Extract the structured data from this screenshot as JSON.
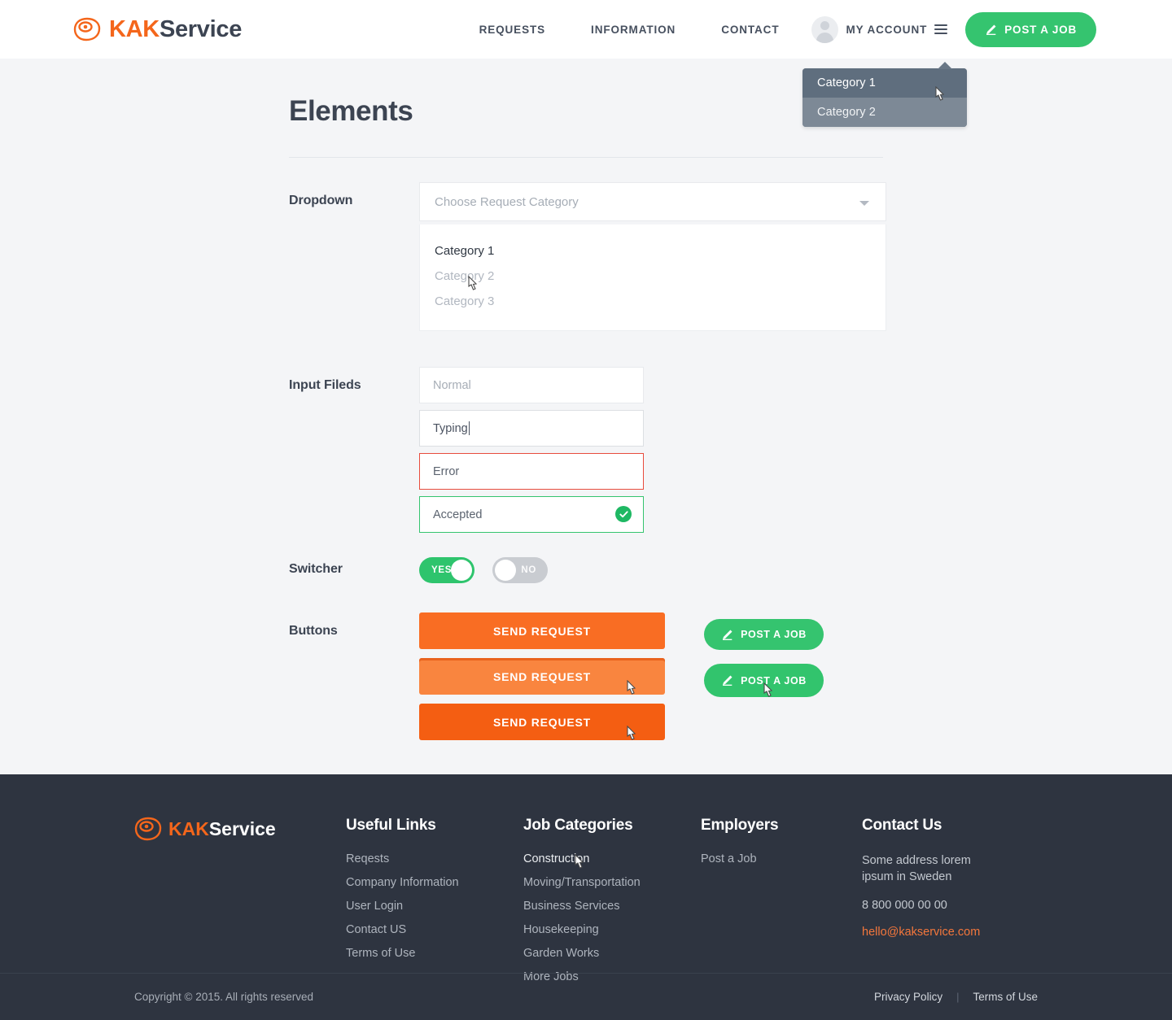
{
  "brand": {
    "mark": "kak-logo-icon",
    "name_primary": "KAK",
    "name_secondary": "Service"
  },
  "header": {
    "nav": [
      {
        "label": "REQUESTS"
      },
      {
        "label": "INFORMATION"
      },
      {
        "label": "CONTACT"
      }
    ],
    "account_label": "MY ACCOUNT",
    "post_job_label": "POST A JOB"
  },
  "tooltip_menu": {
    "items": [
      {
        "label": "Category 1",
        "state": "hovered"
      },
      {
        "label": "Category 2",
        "state": "normal"
      }
    ]
  },
  "main": {
    "title": "Elements",
    "dropdown": {
      "label": "Dropdown",
      "placeholder": "Choose Request Category",
      "options": [
        {
          "label": "Category 1",
          "state": "hovered"
        },
        {
          "label": "Category 2",
          "state": "normal"
        },
        {
          "label": "Category 3",
          "state": "normal"
        }
      ]
    },
    "inputs": {
      "label": "Input Fileds",
      "normal_placeholder": "Normal",
      "typing_value": "Typing",
      "error_value": "Error",
      "accepted_value": "Accepted",
      "accepted_icon": "check-circle-icon"
    },
    "switcher": {
      "label": "Switcher",
      "on_label": "YES",
      "off_label": "NO"
    },
    "buttons": {
      "label": "Buttons",
      "send_request_label": "SEND REQUEST",
      "post_job_label": "POST A JOB",
      "states": [
        "normal",
        "hover",
        "active"
      ]
    }
  },
  "footer": {
    "columns": [
      {
        "title": "Useful Links",
        "links": [
          "Reqests",
          "Company Information",
          "User Login",
          "Contact US",
          "Terms of Use"
        ]
      },
      {
        "title": "Job Categories",
        "links": [
          "Construction",
          "Moving/Transportation",
          "Business Services",
          "Housekeeping",
          "Garden Works",
          "More Jobs"
        ]
      },
      {
        "title": "Employers",
        "links": [
          "Post a Job"
        ]
      }
    ],
    "contact": {
      "title": "Contact Us",
      "address": "Some address lorem ipsum in Sweden",
      "phone": "8 800 000 00 00",
      "email": "hello@kakservice.com"
    },
    "copyright": "Copyright © 2015. All rights reserved",
    "legal": {
      "privacy": "Privacy Policy",
      "separator": "|",
      "terms": "Terms of Use"
    }
  },
  "colors": {
    "orange": "#f4661b",
    "orange_button": "#f96d23",
    "orange_hover": "#f9853f",
    "orange_active": "#f45e12",
    "green": "#35c46f",
    "error_red": "#e84c3d",
    "dark": "#2e3440",
    "page_bg": "#f4f5f7",
    "tooltip_bg": "#697786"
  }
}
